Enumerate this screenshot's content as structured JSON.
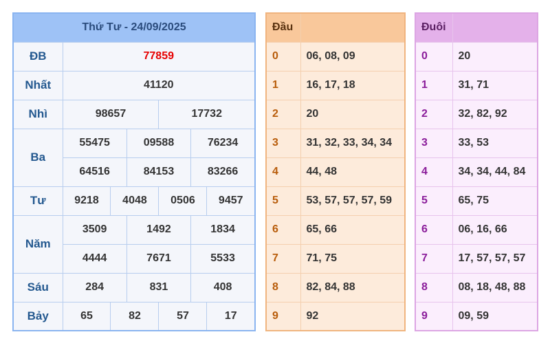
{
  "title": "Thứ Tư - 24/09/2025",
  "prizes": {
    "db": {
      "label": "ĐB",
      "numbers": [
        "77859"
      ]
    },
    "nhat": {
      "label": "Nhất",
      "numbers": [
        "41120"
      ]
    },
    "nhi": {
      "label": "Nhì",
      "numbers": [
        "98657",
        "17732"
      ]
    },
    "ba": {
      "label": "Ba",
      "numbers": [
        "55475",
        "09588",
        "76234",
        "64516",
        "84153",
        "83266"
      ]
    },
    "tu": {
      "label": "Tư",
      "numbers": [
        "9218",
        "4048",
        "0506",
        "9457"
      ]
    },
    "nam": {
      "label": "Năm",
      "numbers": [
        "3509",
        "1492",
        "1834",
        "4444",
        "7671",
        "5533"
      ]
    },
    "sau": {
      "label": "Sáu",
      "numbers": [
        "284",
        "831",
        "408"
      ]
    },
    "bay": {
      "label": "Bảy",
      "numbers": [
        "65",
        "82",
        "57",
        "17"
      ]
    }
  },
  "dau": {
    "header": "Đầu",
    "rows": [
      {
        "digit": "0",
        "values": "06, 08, 09"
      },
      {
        "digit": "1",
        "values": "16, 17, 18"
      },
      {
        "digit": "2",
        "values": "20"
      },
      {
        "digit": "3",
        "values": "31, 32, 33, 34, 34"
      },
      {
        "digit": "4",
        "values": "44, 48"
      },
      {
        "digit": "5",
        "values": "53, 57, 57, 57, 59"
      },
      {
        "digit": "6",
        "values": "65, 66"
      },
      {
        "digit": "7",
        "values": "71, 75"
      },
      {
        "digit": "8",
        "values": "82, 84, 88"
      },
      {
        "digit": "9",
        "values": "92"
      }
    ]
  },
  "duoi": {
    "header": "Đuôi",
    "rows": [
      {
        "digit": "0",
        "values": "20"
      },
      {
        "digit": "1",
        "values": "31, 71"
      },
      {
        "digit": "2",
        "values": "32, 82, 92"
      },
      {
        "digit": "3",
        "values": "33, 53"
      },
      {
        "digit": "4",
        "values": "34, 34, 44, 84"
      },
      {
        "digit": "5",
        "values": "65, 75"
      },
      {
        "digit": "6",
        "values": "06, 16, 66"
      },
      {
        "digit": "7",
        "values": "17, 57, 57, 57"
      },
      {
        "digit": "8",
        "values": "08, 18, 48, 88"
      },
      {
        "digit": "9",
        "values": "09, 59"
      }
    ]
  },
  "colors": {
    "special_prize": "#e60000",
    "results_header": "#9ec2f6",
    "dau_header": "#f9c89b",
    "duoi_header": "#e4b1ea"
  }
}
